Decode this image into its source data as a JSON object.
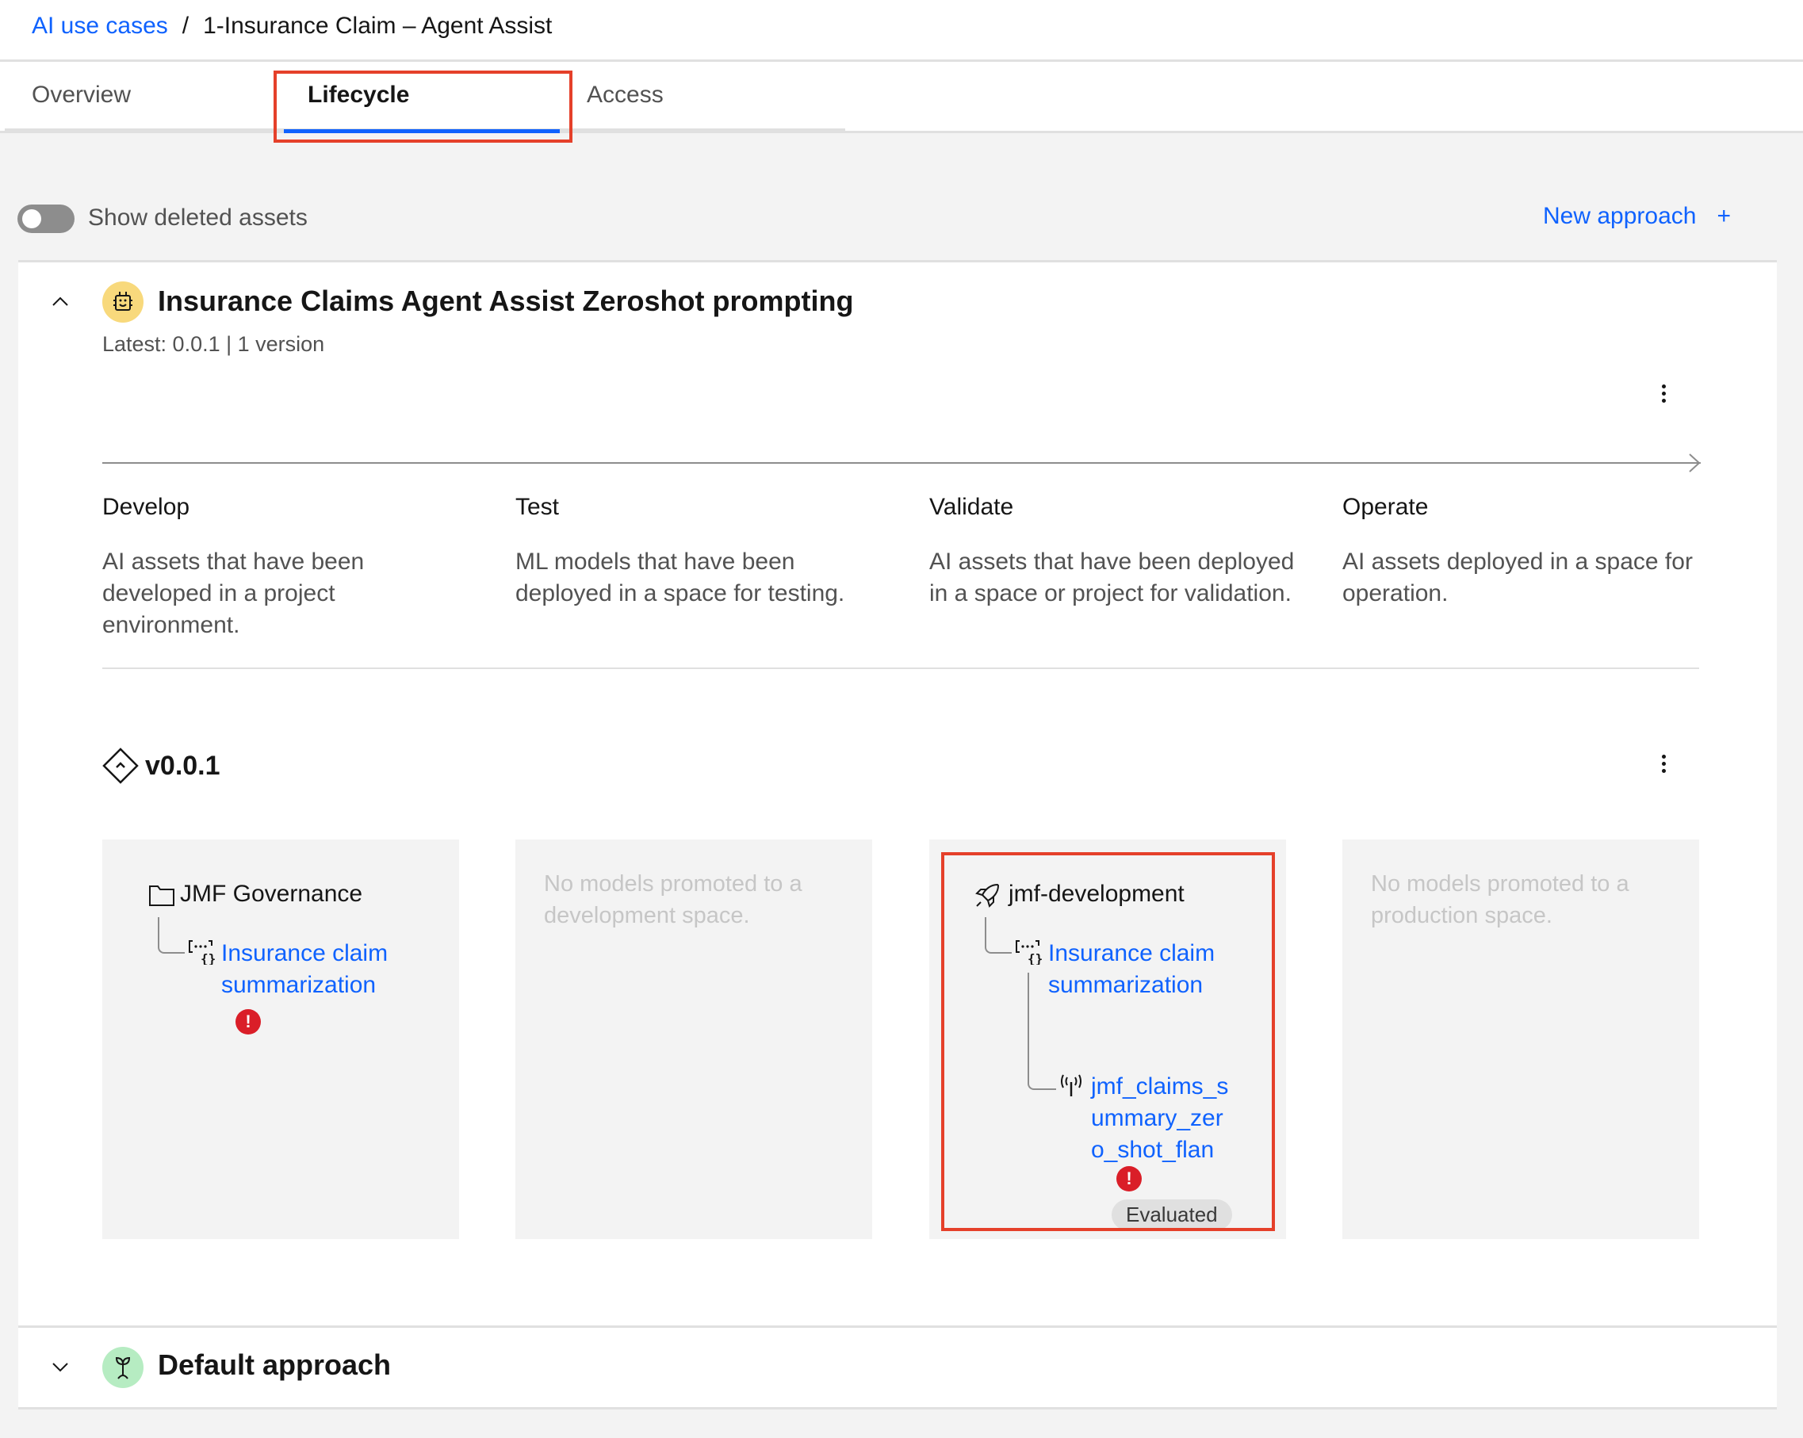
{
  "breadcrumb": {
    "parent": "AI use cases",
    "separator": "/",
    "current": "1-Insurance Claim – Agent Assist"
  },
  "tabs": [
    {
      "label": "Overview",
      "active": false
    },
    {
      "label": "Lifecycle",
      "active": true
    },
    {
      "label": "Access",
      "active": false
    }
  ],
  "toolbar": {
    "toggle_label": "Show deleted assets",
    "toggle_on": false,
    "new_approach_label": "New approach",
    "new_approach_icon": "+"
  },
  "approach": {
    "title": "Insurance Claims Agent Assist Zeroshot prompting",
    "subtitle": "Latest: 0.0.1 | 1 version",
    "icon": "robot-icon",
    "icon_color": "#f8d97c",
    "expanded": true
  },
  "stages": [
    {
      "name": "Develop",
      "description": "AI assets that have been developed in a project environment."
    },
    {
      "name": "Test",
      "description": "ML models that have been deployed in a space for testing."
    },
    {
      "name": "Validate",
      "description": "AI assets that have been deployed in a space or project for validation."
    },
    {
      "name": "Operate",
      "description": "AI assets deployed in a space for operation."
    }
  ],
  "version": {
    "label": "v0.0.1",
    "columns": {
      "develop": {
        "container": "JMF Governance",
        "container_icon": "folder-icon",
        "asset": "Insurance claim summarization",
        "asset_icon": "prompt-template-icon",
        "asset_error": true
      },
      "test": {
        "empty_message": "No models promoted to a development space."
      },
      "validate": {
        "container": "jmf-development",
        "container_icon": "rocket-icon",
        "asset": "Insurance claim summarization",
        "asset_icon": "prompt-template-icon",
        "deployment": "jmf_claims_summary_zero_shot_flan",
        "deployment_lines": [
          "jmf_claims_s",
          "ummary_zer",
          "o_shot_flan"
        ],
        "deployment_icon": "deployment-antenna-icon",
        "deployment_error": true,
        "deployment_tag": "Evaluated"
      },
      "operate": {
        "empty_message": "No models promoted to a production space."
      }
    }
  },
  "default_approach": {
    "title": "Default approach",
    "icon": "sprout-icon",
    "icon_color": "#b6ecc2",
    "expanded": false
  },
  "colors": {
    "link": "#0f62fe",
    "error": "#da1e28",
    "highlight": "#e5402a"
  }
}
